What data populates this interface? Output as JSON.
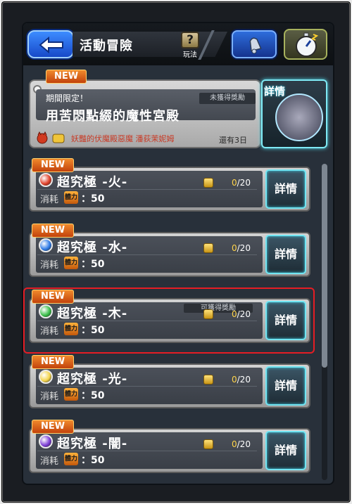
{
  "header": {
    "title": "活動冒險",
    "help_label": "玩法",
    "help_glyph": "?"
  },
  "banner": {
    "new_badge": "NEW",
    "limited_label": "期間限定！",
    "status": "未獲得獎勵",
    "title": "用苦悶點綴的魔性宮殿",
    "subtitle": "妖豔的伏魔殿惡魔 潘荻茉妮姆",
    "remaining": "還有3日",
    "details_label": "詳情"
  },
  "quests": [
    {
      "new": "NEW",
      "title": "超究極 -火-",
      "element": "fire",
      "color": "#e0412a",
      "progress_done": "0",
      "progress_total": "/20",
      "reward_badge": "",
      "cost_label": "消耗",
      "stamina_glyph": "體力",
      "cost": "：50",
      "details": "詳情"
    },
    {
      "new": "NEW",
      "title": "超究極 -水-",
      "element": "water",
      "color": "#2f7be6",
      "progress_done": "0",
      "progress_total": "/20",
      "reward_badge": "",
      "cost_label": "消耗",
      "stamina_glyph": "體力",
      "cost": "：50",
      "details": "詳情"
    },
    {
      "new": "NEW",
      "title": "超究極 -木-",
      "element": "wood",
      "color": "#3bbf4a",
      "progress_done": "0",
      "progress_total": "/20",
      "reward_badge": "可獲得獎勵",
      "cost_label": "消耗",
      "stamina_glyph": "體力",
      "cost": "：50",
      "details": "詳情"
    },
    {
      "new": "NEW",
      "title": "超究極 -光-",
      "element": "light",
      "color": "#f3d44b",
      "progress_done": "0",
      "progress_total": "/20",
      "reward_badge": "",
      "cost_label": "消耗",
      "stamina_glyph": "體力",
      "cost": "：50",
      "details": "詳情"
    },
    {
      "new": "NEW",
      "title": "超究極 -闇-",
      "element": "dark",
      "color": "#7d3fd6",
      "progress_done": "0",
      "progress_total": "/20",
      "reward_badge": "",
      "cost_label": "消耗",
      "stamina_glyph": "體力",
      "cost": "：50",
      "details": "詳情"
    }
  ]
}
